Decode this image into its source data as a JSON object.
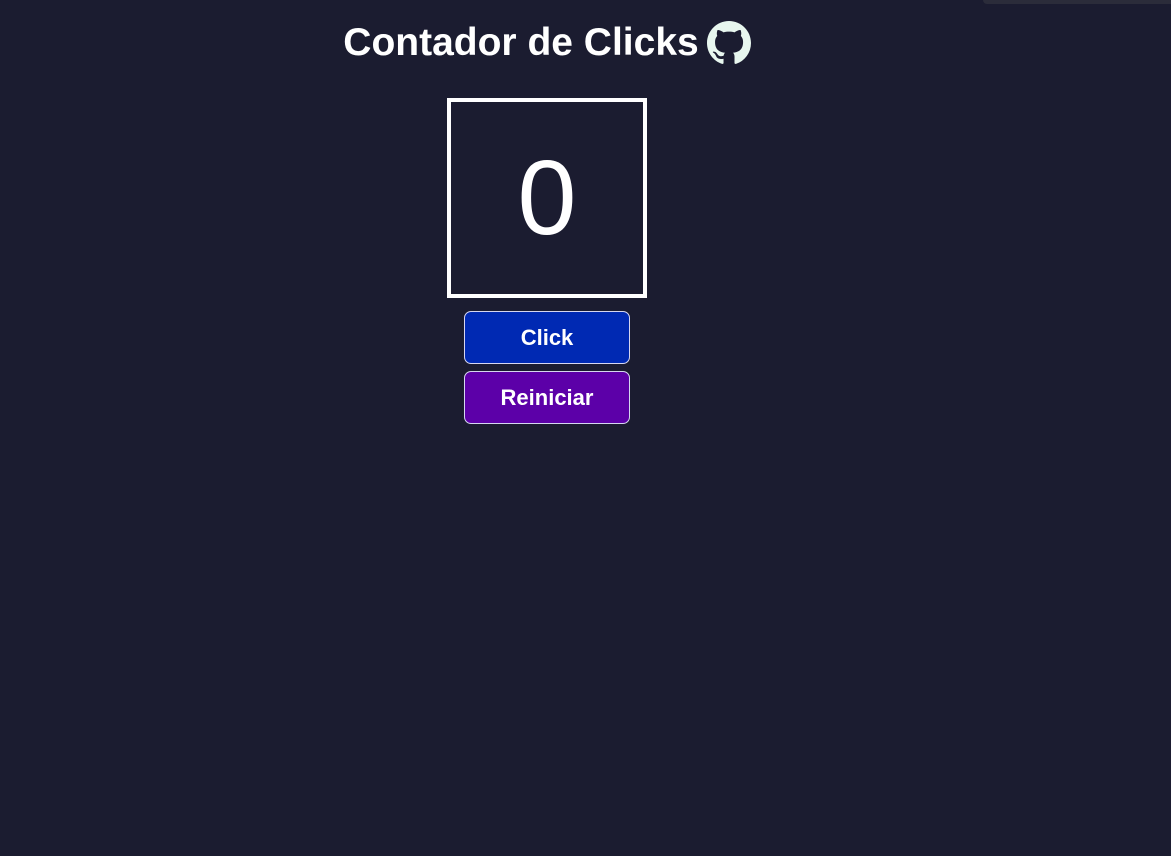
{
  "header": {
    "title": "Contador de Clicks",
    "icon": "github-icon"
  },
  "counter": {
    "value": "0"
  },
  "buttons": {
    "click_label": "Click",
    "reset_label": "Reiniciar"
  },
  "colors": {
    "background": "#1b1c30",
    "text": "#ffffff",
    "click_button": "#0029b3",
    "reset_button": "#5c00a8",
    "github_icon": "#e8f7ef"
  }
}
